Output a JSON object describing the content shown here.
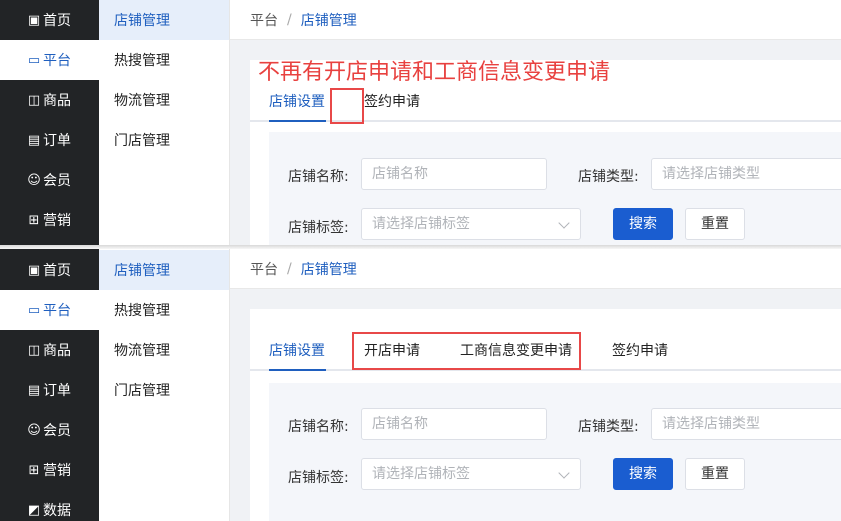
{
  "nav": {
    "items": [
      {
        "label": "首页",
        "icon": "monitor-icon",
        "glyph": "▣"
      },
      {
        "label": "平台",
        "icon": "desktop-icon",
        "glyph": "▭"
      },
      {
        "label": "商品",
        "icon": "shopping-bag-icon",
        "glyph": "◫"
      },
      {
        "label": "订单",
        "icon": "document-icon",
        "glyph": "▤"
      },
      {
        "label": "会员",
        "icon": "users-icon",
        "glyph": "☺"
      },
      {
        "label": "营销",
        "icon": "gift-icon",
        "glyph": "⊞"
      },
      {
        "label": "数据",
        "icon": "chart-icon",
        "glyph": "◩"
      }
    ]
  },
  "subnav": {
    "items": [
      {
        "label": "店铺管理"
      },
      {
        "label": "热搜管理"
      },
      {
        "label": "物流管理"
      },
      {
        "label": "门店管理"
      }
    ]
  },
  "breadcrumb": {
    "root": "平台",
    "separator": "/",
    "current": "店铺管理"
  },
  "annotation": "不再有开店申请和工商信息变更申请",
  "tabs_top": {
    "shop_settings": "店铺设置",
    "sign_apply": "签约申请"
  },
  "tabs_bottom": {
    "shop_settings": "店铺设置",
    "open_apply": "开店申请",
    "business_change": "工商信息变更申请",
    "sign_apply": "签约申请"
  },
  "filter": {
    "shop_name_label": "店铺名称:",
    "shop_name_placeholder": "店铺名称",
    "shop_type_label": "店铺类型:",
    "shop_type_placeholder": "请选择店铺类型",
    "shop_tag_label": "店铺标签:",
    "shop_tag_placeholder": "请选择店铺标签",
    "search_label": "搜索",
    "reset_label": "重置"
  },
  "colors": {
    "accent": "#1f5fbf",
    "annotation": "#e8413f",
    "sidebar": "#222426"
  }
}
